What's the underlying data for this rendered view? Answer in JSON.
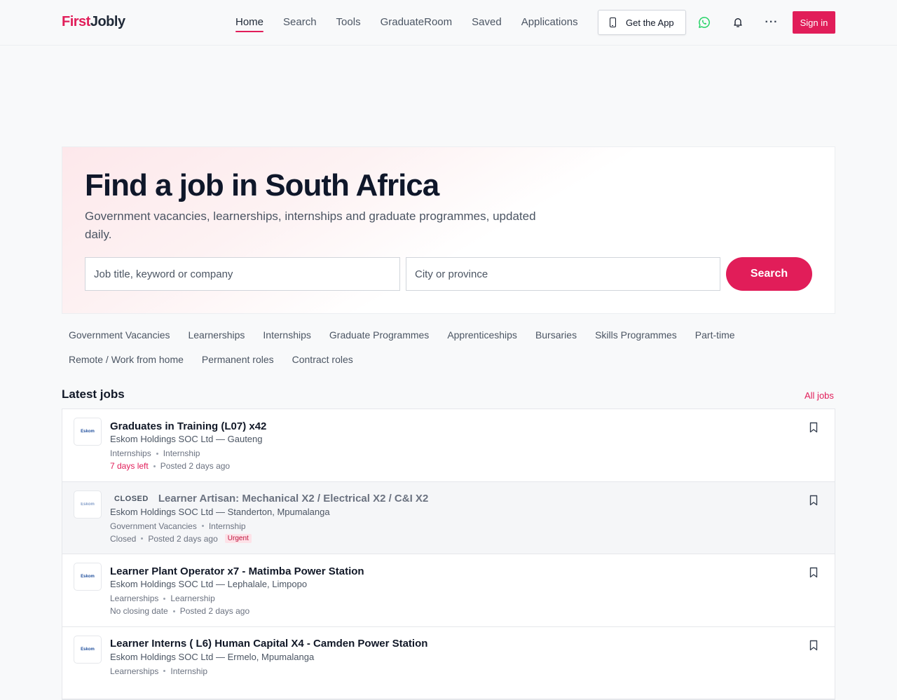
{
  "brand": {
    "first": "First",
    "second": "Jobly"
  },
  "nav": [
    {
      "label": "Home",
      "active": true
    },
    {
      "label": "Search",
      "active": false
    },
    {
      "label": "Tools",
      "active": false
    },
    {
      "label": "GraduateRoom",
      "active": false
    },
    {
      "label": "Saved",
      "active": false
    },
    {
      "label": "Applications",
      "active": false
    }
  ],
  "header": {
    "get_app_label": "Get the App",
    "sign_in_label": "Sign in",
    "more_label": "···",
    "icons": [
      "phone-icon",
      "whatsapp-icon",
      "bell-icon",
      "more-icon"
    ]
  },
  "hero": {
    "title": "Find a job in South Africa",
    "subtitle": "Government vacancies, learnerships, internships and graduate programmes, updated daily.",
    "keyword_placeholder": "Job title, keyword or company",
    "location_placeholder": "City or province",
    "search_label": "Search"
  },
  "categories": {
    "row1": [
      "Government Vacancies",
      "Learnerships",
      "Internships",
      "Graduate Programmes",
      "Apprenticeships",
      "Bursaries",
      "Skills Programmes",
      "Part-time"
    ],
    "row2": [
      "Remote / Work from home",
      "Permanent roles",
      "Contract roles"
    ]
  },
  "latest": {
    "title": "Latest jobs",
    "all_label": "All jobs",
    "jobs": [
      {
        "logo_text": "Eskom",
        "closed": false,
        "closed_label": "",
        "title": "Graduates in Training (L07) x42",
        "company": "Eskom Holdings SOC Ltd — Gauteng",
        "category": "Internships",
        "type": "Internship",
        "deadline": "7 days left",
        "deadline_urgent": true,
        "posted": "Posted 2 days ago",
        "urgent_badge": ""
      },
      {
        "logo_text": "Eskom",
        "closed": true,
        "closed_label": "CLOSED",
        "title": "Learner Artisan: Mechanical X2 / Electrical X2 / C&I X2",
        "company": "Eskom Holdings SOC Ltd — Standerton, Mpumalanga",
        "category": "Government Vacancies",
        "type": "Internship",
        "deadline": "Closed",
        "deadline_urgent": false,
        "posted": "Posted 2 days ago",
        "urgent_badge": "Urgent"
      },
      {
        "logo_text": "Eskom",
        "closed": false,
        "closed_label": "",
        "title": "Learner Plant Operator x7 - Matimba Power Station",
        "company": "Eskom Holdings SOC Ltd — Lephalale, Limpopo",
        "category": "Learnerships",
        "type": "Learnership",
        "deadline": "No closing date",
        "deadline_urgent": false,
        "posted": "Posted 2 days ago",
        "urgent_badge": ""
      },
      {
        "logo_text": "Eskom",
        "closed": false,
        "closed_label": "",
        "title": "Learner Interns ( L6) Human Capital X4 - Camden Power Station",
        "company": "Eskom Holdings SOC Ltd — Ermelo, Mpumalanga",
        "category": "Learnerships",
        "type": "Internship",
        "deadline": "",
        "deadline_urgent": false,
        "posted": "",
        "urgent_badge": ""
      }
    ]
  },
  "colors": {
    "accent": "#e11d59",
    "text": "#111827",
    "muted": "#4b5563",
    "whatsapp": "#25d366"
  }
}
